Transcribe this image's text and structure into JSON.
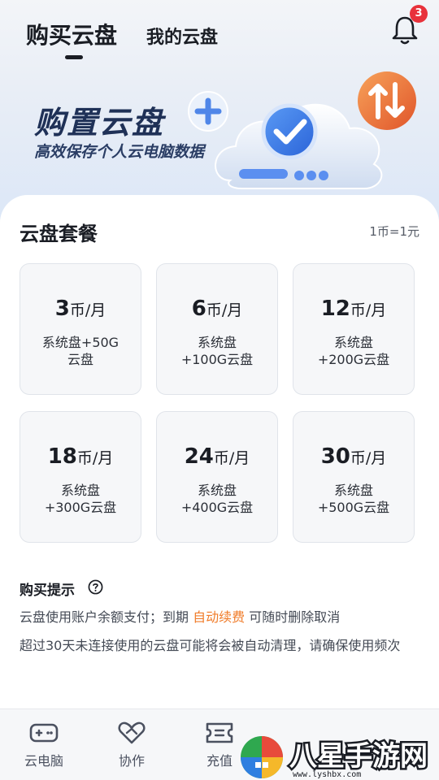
{
  "header": {
    "tab_active": "购买云盘",
    "tab_inactive": "我的云盘",
    "notification_count": "3"
  },
  "banner": {
    "title": "购置云盘",
    "subtitle": "高效保存个人云电脑数据"
  },
  "plans_section": {
    "title": "云盘套餐",
    "rate": "1币=1元",
    "plans": [
      {
        "amount": "3",
        "unit": "币/月",
        "desc_line1": "系统盘+50G",
        "desc_line2": "云盘"
      },
      {
        "amount": "6",
        "unit": "币/月",
        "desc_line1": "系统盘",
        "desc_line2": "+100G云盘"
      },
      {
        "amount": "12",
        "unit": "币/月",
        "desc_line1": "系统盘",
        "desc_line2": "+200G云盘"
      },
      {
        "amount": "18",
        "unit": "币/月",
        "desc_line1": "系统盘",
        "desc_line2": "+300G云盘"
      },
      {
        "amount": "24",
        "unit": "币/月",
        "desc_line1": "系统盘",
        "desc_line2": "+400G云盘"
      },
      {
        "amount": "30",
        "unit": "币/月",
        "desc_line1": "系统盘",
        "desc_line2": "+500G云盘"
      }
    ]
  },
  "tips": {
    "title": "购买提示",
    "line1_prefix": "云盘使用账户余额支付；到期 ",
    "line1_link": "自动续费",
    "line1_suffix": " 可随时删除取消",
    "line2": "超过30天未连接使用的云盘可能将会被自动清理，请确保使用频次"
  },
  "bottom_nav": {
    "items": [
      {
        "label": "云电脑",
        "icon": "gamepad-icon"
      },
      {
        "label": "协作",
        "icon": "handshake-heart-icon"
      },
      {
        "label": "充值",
        "icon": "ticket-icon"
      }
    ]
  },
  "watermark": {
    "text": "八星手游网",
    "url": "www.lyshbx.com"
  },
  "colors": {
    "accent_orange": "#f07c2a",
    "badge_red": "#e8323b",
    "banner_navy": "#1f3157"
  }
}
